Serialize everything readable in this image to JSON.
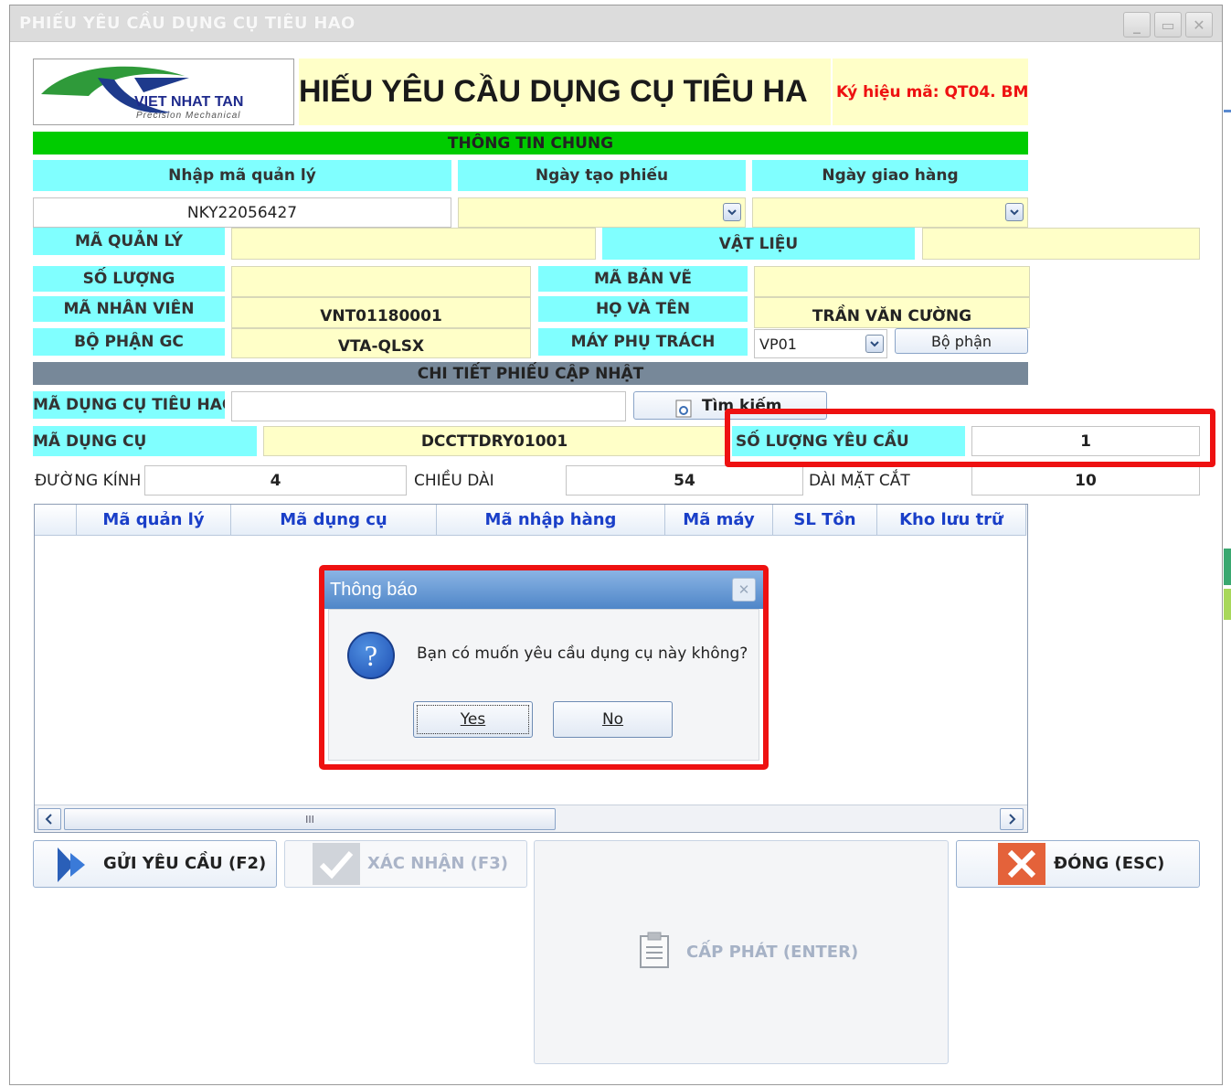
{
  "window": {
    "title": "PHIẾU YÊU CẦU DỤNG CỤ TIÊU HAO"
  },
  "header": {
    "logo_text": "VIET NHAT TAN",
    "logo_subtext": "Precision Mechanical",
    "form_title": "HIẾU YÊU CẦU DỤNG CỤ TIÊU HA",
    "form_code": "Ký hiệu mã: QT04. BM"
  },
  "general": {
    "section_title": "THÔNG TIN CHUNG",
    "col_management_code": "Nhập mã quản lý",
    "col_created_date": "Ngày tạo phiếu",
    "col_delivery_date": "Ngày giao hàng",
    "management_code_value": "NKY22056427",
    "created_date_value": "",
    "delivery_date_value": ""
  },
  "fields": {
    "ma_quan_ly_label": "MÃ QUẢN LÝ",
    "ma_quan_ly_value": "",
    "vat_lieu_label": "VẬT LIỆU",
    "vat_lieu_value": "",
    "so_luong_label": "SỐ LƯỢNG",
    "so_luong_value": "",
    "ma_ban_ve_label": "MÃ BẢN VẼ",
    "ma_ban_ve_value": "",
    "ma_nhan_vien_label": "MÃ NHÂN VIÊN",
    "ma_nhan_vien_value": "VNT01180001",
    "ho_va_ten_label": "HỌ VÀ TÊN",
    "ho_va_ten_value": "TRẦN VĂN CƯỜNG",
    "bo_phan_gc_label": "BỘ PHẬN GC",
    "bo_phan_gc_value": "VTA-QLSX",
    "may_phu_trach_label": "MÁY PHỤ TRÁCH",
    "may_phu_trach_value": "VP01",
    "bo_phan_button": "Bộ phận"
  },
  "detail": {
    "section_title": "CHI TIẾT PHIẾU CẬP NHẬT",
    "ma_dung_cu_tieu_hao_label": "MÃ DỤNG CỤ TIÊU HAO",
    "ma_dung_cu_tieu_hao_value": "",
    "search_button": "Tìm kiếm",
    "ma_dung_cu_label": "MÃ DỤNG CỤ",
    "ma_dung_cu_value": "DCCTTDRY01001",
    "so_luong_yeu_cau_label": "SỐ LƯỢNG YÊU CẦU",
    "so_luong_yeu_cau_value": "1",
    "duong_kinh_label": "ĐƯỜNG KÍNH",
    "duong_kinh_value": "4",
    "chieu_dai_label": "CHIỀU DÀI",
    "chieu_dai_value": "54",
    "dai_mat_cat_label": "DÀI MẶT CẮT",
    "dai_mat_cat_value": "10"
  },
  "grid": {
    "columns": [
      "Mã quản lý",
      "Mã dụng cụ",
      "Mã nhập hàng",
      "Mã máy",
      "SL Tồn",
      "Kho lưu trữ"
    ],
    "scroll_thumb_glyph": "III"
  },
  "dialog": {
    "title": "Thông báo",
    "message": "Bạn có muốn yêu cầu dụng cụ này không?",
    "yes_label": "Yes",
    "no_label": "No"
  },
  "actions": {
    "send_request": "GỬI YÊU CẦU (F2)",
    "confirm": "XÁC NHẬN (F3)",
    "issue": "CẤP PHÁT (ENTER)",
    "close": "ĐÓNG (ESC)"
  },
  "colors": {
    "label_bg": "#80ffff",
    "field_bg": "#ffffc8",
    "section_green": "#00cc00",
    "section_gray": "#778899",
    "highlight_red": "#ee1111",
    "grid_header_text": "#1a3fc8"
  }
}
